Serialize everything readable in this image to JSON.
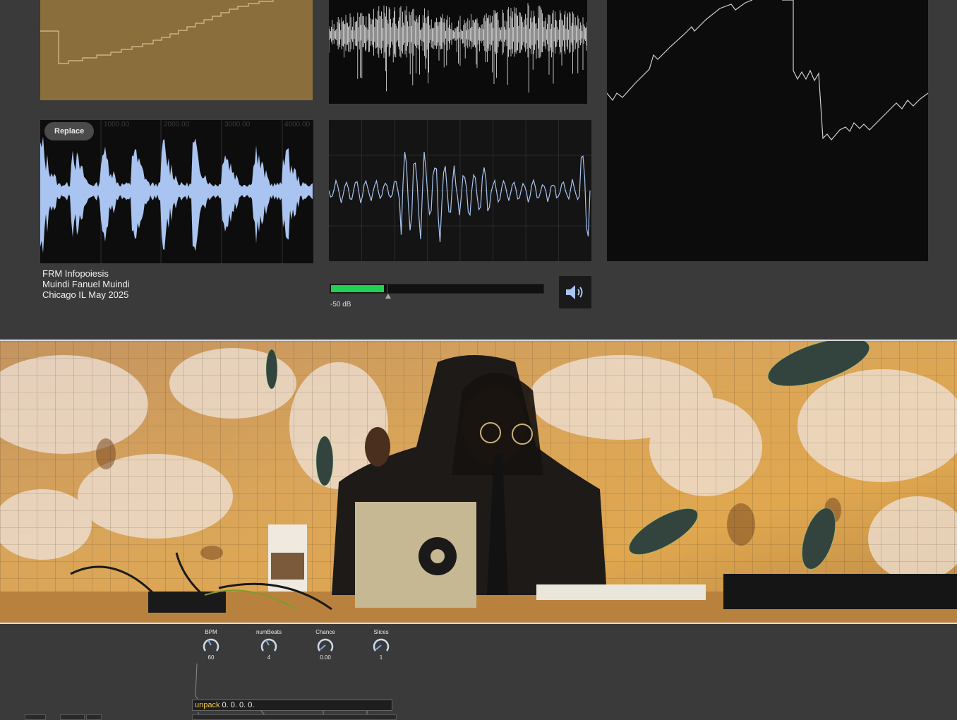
{
  "buffer": {
    "replace_label": "Replace",
    "ticks": [
      "1000.00",
      "2000.00",
      "3000.00",
      "4000.00"
    ]
  },
  "info": {
    "line1": "FRM Infopoiesis",
    "line2": "Muindi Fanuel Muindi",
    "line3": "Chicago IL May 2025"
  },
  "meter": {
    "level_fraction": 0.25,
    "threshold_label": "-50 dB"
  },
  "colors": {
    "gold_scope": "#8a6f3c",
    "buffer_wave": "#a9c4f0",
    "meter_green": "#22d055",
    "dial_accent": "#7fa8e8"
  },
  "icons": {
    "speaker": "speaker-icon"
  },
  "dials": [
    {
      "name": "BPM",
      "value": "60"
    },
    {
      "name": "numBeats",
      "value": "4"
    },
    {
      "name": "Chance",
      "value": "0.00"
    },
    {
      "name": "Slices",
      "value": "1"
    }
  ],
  "unpack": {
    "keyword": "unpack",
    "args": "0. 0. 0. 0."
  }
}
